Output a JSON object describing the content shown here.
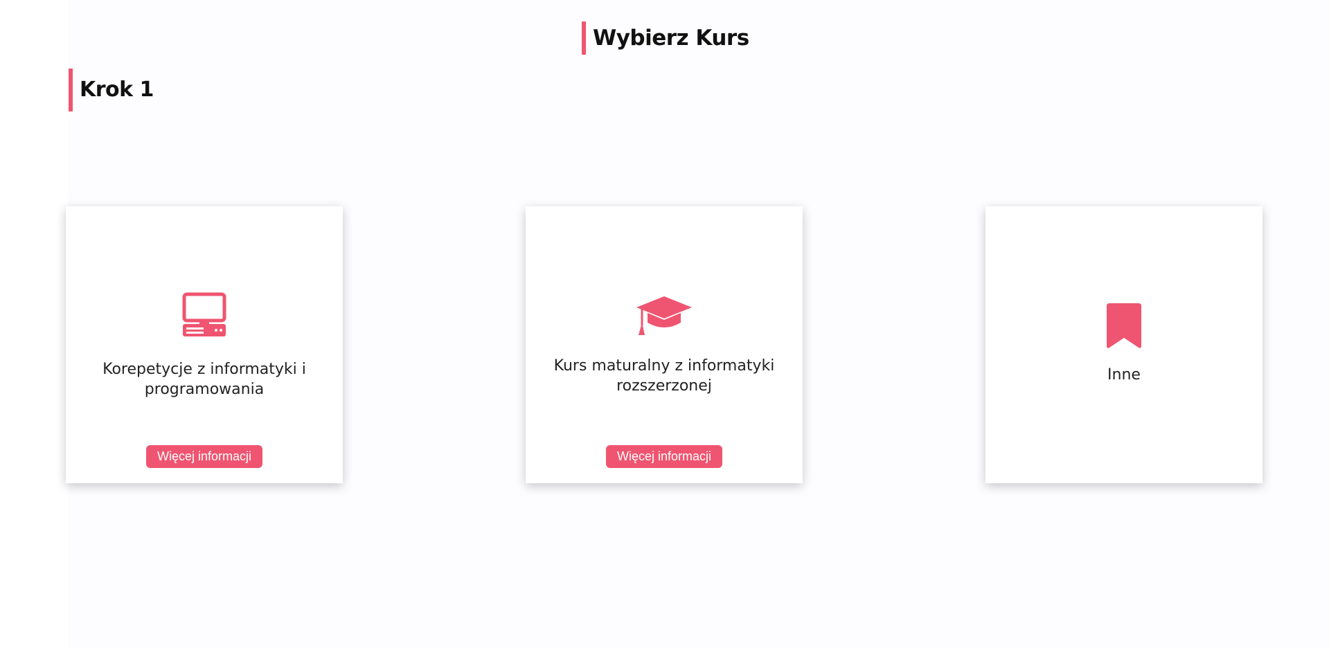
{
  "header": {
    "title": "Wybierz Kurs",
    "step": "Krok 1"
  },
  "theme": {
    "accent": "#ef5570",
    "background": "#fdfcfe"
  },
  "cards": [
    {
      "icon": "desktop-computer-icon",
      "label": "Korepetycje z informatyki i programowania",
      "button_label": "Więcej informacji"
    },
    {
      "icon": "graduation-cap-icon",
      "label": "Kurs maturalny z informatyki rozszerzonej",
      "button_label": "Więcej informacji"
    },
    {
      "icon": "bookmark-icon",
      "label": "Inne"
    }
  ]
}
